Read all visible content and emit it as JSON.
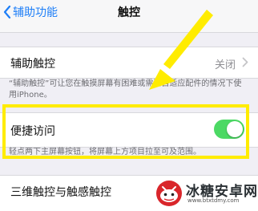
{
  "nav": {
    "back_label": "辅助功能",
    "title": "触控"
  },
  "assistive_touch": {
    "label": "辅助触控",
    "value": "关闭",
    "note": "“辅助触控”可让您在触摸屏幕有困难或需要自适应配件的情况下使用iPhone。"
  },
  "quick_access": {
    "label": "便捷访问",
    "enabled": true,
    "note": "轻点两下主屏幕按钮，将屏幕上方项目拉至可及范围。"
  },
  "touch_3d": {
    "label": "三维触控与触感触控"
  },
  "watermark": {
    "title": "冰糖安卓网",
    "url": "www.btxtdmy.com"
  },
  "colors": {
    "accent": "#1d7ef7",
    "toggle_on": "#4cd964",
    "highlight": "#ffec00"
  }
}
